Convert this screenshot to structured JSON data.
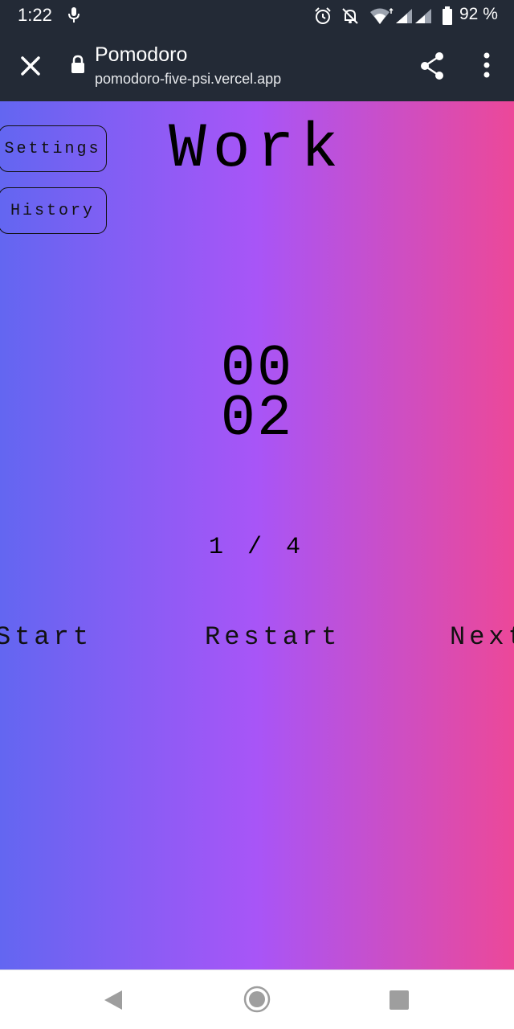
{
  "status_bar": {
    "time": "1:22",
    "battery": "92 %"
  },
  "browser": {
    "title": "Pomodoro",
    "url": "pomodoro-five-psi.vercel.app"
  },
  "app": {
    "settings_label": "Settings",
    "history_label": "History",
    "mode": "Work",
    "timer_minutes": "00",
    "timer_seconds": "02",
    "round": "1 / 4",
    "start_label": "Start",
    "restart_label": "Restart",
    "next_label": "Next"
  },
  "colors": {
    "gradient_start": "#6366f1",
    "gradient_mid": "#a855f7",
    "gradient_end": "#ec4899",
    "chrome_bg": "#232a36"
  },
  "icons": [
    "mic-icon",
    "alarm-icon",
    "notifications-off-icon",
    "wifi-icon",
    "signal-icon",
    "battery-icon",
    "close-icon",
    "lock-icon",
    "share-icon",
    "more-vert-icon",
    "back-icon",
    "home-icon",
    "recents-icon"
  ]
}
